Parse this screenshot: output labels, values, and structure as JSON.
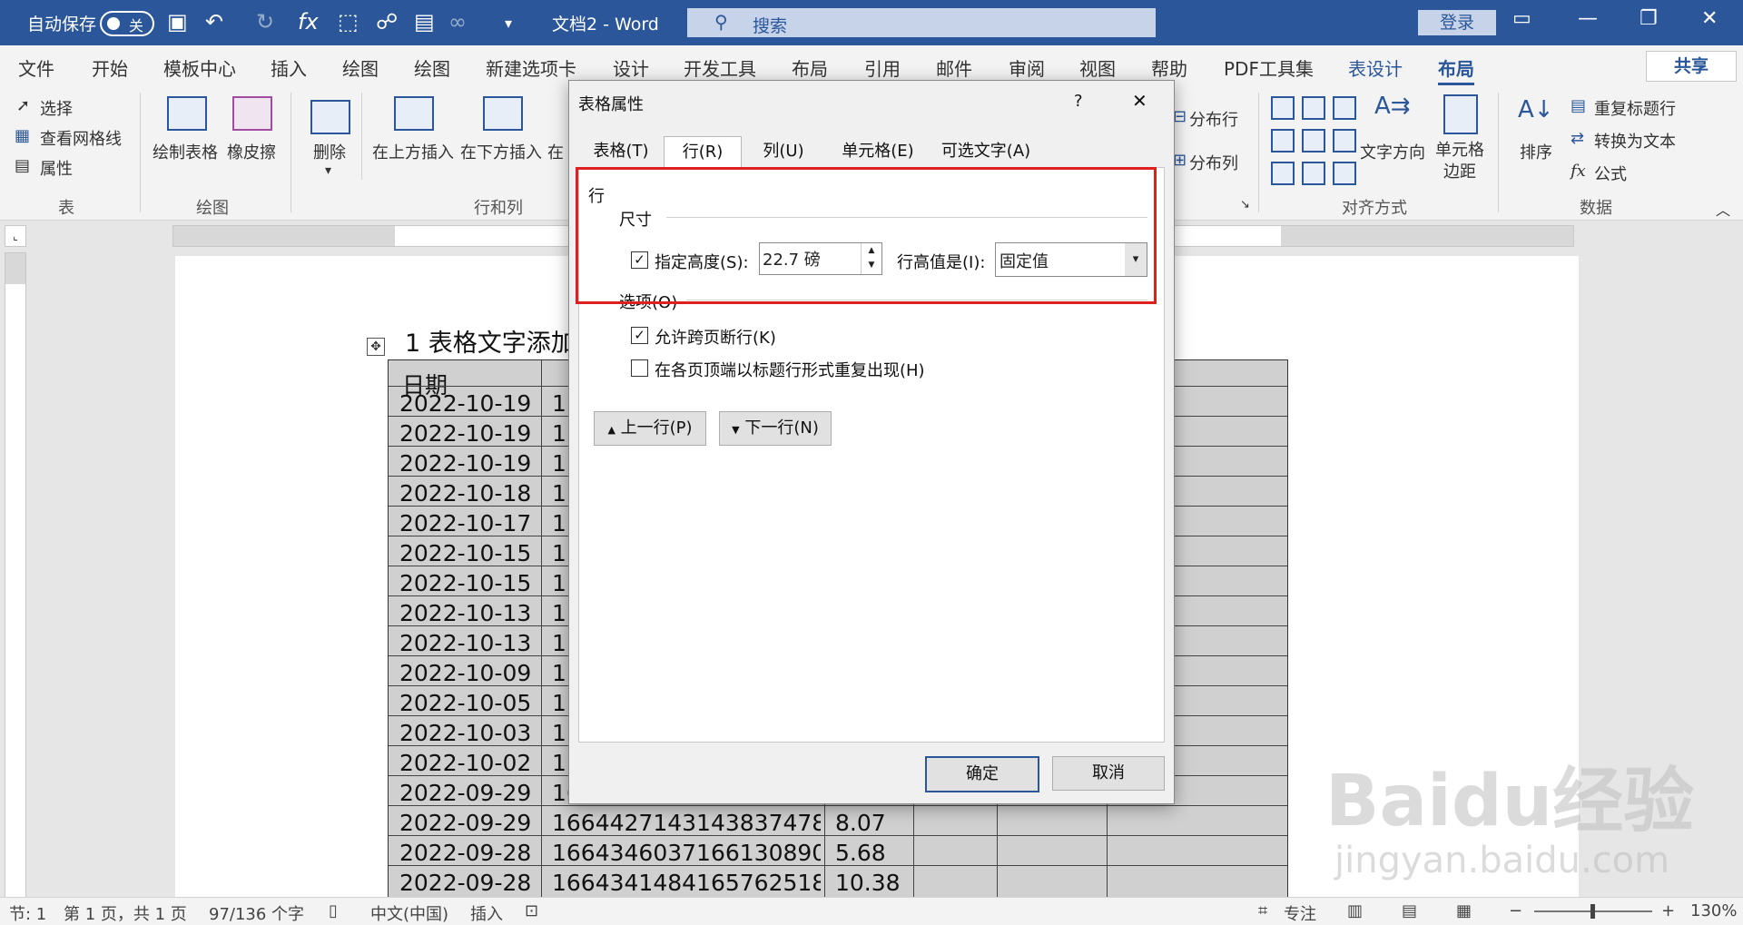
{
  "titlebar": {
    "autosave_label": "自动保存",
    "autosave_state": "关",
    "doc_title": "文档2 - Word",
    "search_placeholder": "搜索",
    "login_label": "登录"
  },
  "tabs": [
    "文件",
    "开始",
    "模板中心",
    "插入",
    "绘图",
    "绘图",
    "新建选项卡",
    "设计",
    "开发工具",
    "布局",
    "引用",
    "邮件",
    "审阅",
    "视图",
    "帮助",
    "PDF工具集",
    "表设计",
    "布局"
  ],
  "share_label": "共享",
  "ribbon": {
    "select_label": "选择",
    "gridlines_label": "查看网格线",
    "properties_label": "属性",
    "group_table": "表",
    "draw_table_label": "绘制表格",
    "eraser_label": "橡皮擦",
    "group_draw": "绘图",
    "delete_label": "删除",
    "insert_above_label": "在上方插入",
    "insert_below_label": "在下方插入",
    "insert_left_partial": "在",
    "group_rows_cols": "行和列",
    "dist_rows_label": "分布行",
    "dist_cols_label": "分布列",
    "text_direction_label": "文字方向",
    "cell_margins_label": "单元格边距",
    "group_align": "对齐方式",
    "sort_label": "排序",
    "repeat_header_label": "重复标题行",
    "convert_text_label": "转换为文本",
    "formula_label": "公式",
    "group_data": "数据"
  },
  "document": {
    "title_text": "1 表格文字添加到",
    "header_partial": "日期",
    "rows": [
      {
        "date": "2022-10-19",
        "id": "1"
      },
      {
        "date": "2022-10-19",
        "id": "1"
      },
      {
        "date": "2022-10-19",
        "id": "1"
      },
      {
        "date": "2022-10-18",
        "id": "1"
      },
      {
        "date": "2022-10-17",
        "id": "1"
      },
      {
        "date": "2022-10-15",
        "id": "1"
      },
      {
        "date": "2022-10-15",
        "id": "1"
      },
      {
        "date": "2022-10-13",
        "id": "1"
      },
      {
        "date": "2022-10-13",
        "id": "1"
      },
      {
        "date": "2022-10-09",
        "id": "1"
      },
      {
        "date": "2022-10-05",
        "id": "1"
      },
      {
        "date": "2022-10-03",
        "id": "1"
      },
      {
        "date": "2022-10-02",
        "id": "1"
      },
      {
        "date": "2022-09-29",
        "id": "1664434"
      },
      {
        "date": "2022-09-29",
        "id": "1664427143143837478",
        "val": "8.07"
      },
      {
        "date": "2022-09-28",
        "id": "1664346037166130890",
        "val": "5.68"
      },
      {
        "date": "2022-09-28",
        "id": "1664341484165762518",
        "val": "10.38"
      }
    ]
  },
  "dialog": {
    "title": "表格属性",
    "help": "?",
    "close": "✕",
    "tabs": [
      "表格(T)",
      "行(R)",
      "列(U)",
      "单元格(E)",
      "可选文字(A)"
    ],
    "section_row": "行",
    "section_size": "尺寸",
    "specify_height_label": "指定高度(S):",
    "specify_height_checked": true,
    "height_value": "22.7 磅",
    "row_height_is_label": "行高值是(I):",
    "row_height_mode": "固定值",
    "section_options": "选项(O)",
    "allow_break_label": "允许跨页断行(K)",
    "allow_break_checked": true,
    "repeat_header_label": "在各页顶端以标题行形式重复出现(H)",
    "repeat_header_checked": false,
    "prev_row_label": "上一行(P)",
    "next_row_label": "下一行(N)",
    "ok_label": "确定",
    "cancel_label": "取消"
  },
  "statusbar": {
    "section": "节: 1",
    "page": "第 1 页，共 1 页",
    "words": "97/136 个字",
    "language": "中文(中国)",
    "insert_mode": "插入",
    "focus_label": "专注",
    "zoom": "130%"
  },
  "watermark": {
    "brand": "Baidu经验",
    "url": "jingyan.baidu.com"
  },
  "colors": {
    "brand": "#2b579a",
    "highlight_box": "#e02020"
  }
}
